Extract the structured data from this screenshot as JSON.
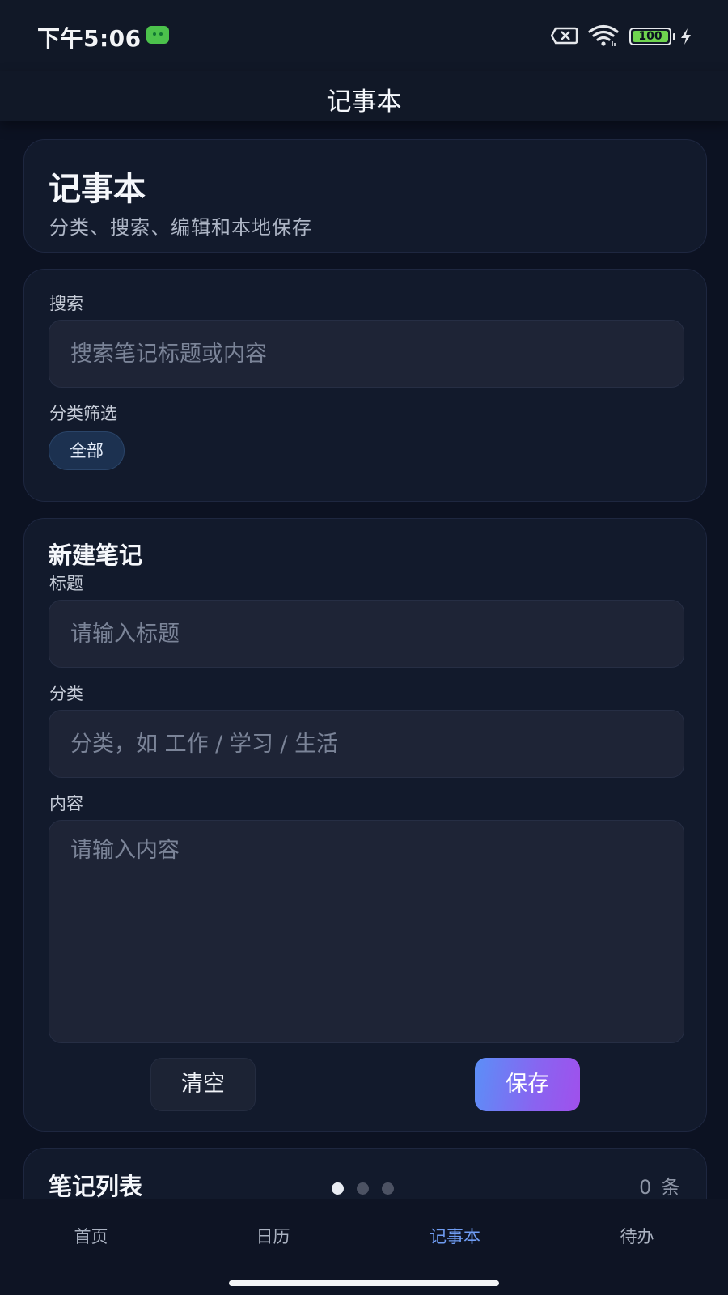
{
  "status_bar": {
    "time": "下午5:06",
    "battery": "100"
  },
  "app_bar": {
    "title": "记事本"
  },
  "header_card": {
    "title": "记事本",
    "subtitle": "分类、搜索、编辑和本地保存"
  },
  "filter_card": {
    "search_label": "搜索",
    "search_placeholder": "搜索笔记标题或内容",
    "search_value": "",
    "category_filter_label": "分类筛选",
    "chips": [
      "全部"
    ],
    "selected_chip": "全部"
  },
  "new_note_card": {
    "title": "新建笔记",
    "title_label": "标题",
    "title_placeholder": "请输入标题",
    "category_label": "分类",
    "category_placeholder": "分类，如 工作 / 学习 / 生活",
    "content_label": "内容",
    "content_placeholder": "请输入内容",
    "clear_button": "清空",
    "save_button": "保存"
  },
  "list_card": {
    "title": "笔记列表",
    "count": "0 条"
  },
  "pager": {
    "page_count": 3,
    "active_index": 0
  },
  "bottom_nav": {
    "items": [
      "首页",
      "日历",
      "记事本",
      "待办"
    ],
    "active": "记事本"
  },
  "colors": {
    "background": "#0c1222",
    "card": "#121a2c",
    "accent": "#6f9cf2",
    "save_gradient_start": "#5b8ff7",
    "save_gradient_end": "#a050ec",
    "battery": "#6fd44f"
  }
}
